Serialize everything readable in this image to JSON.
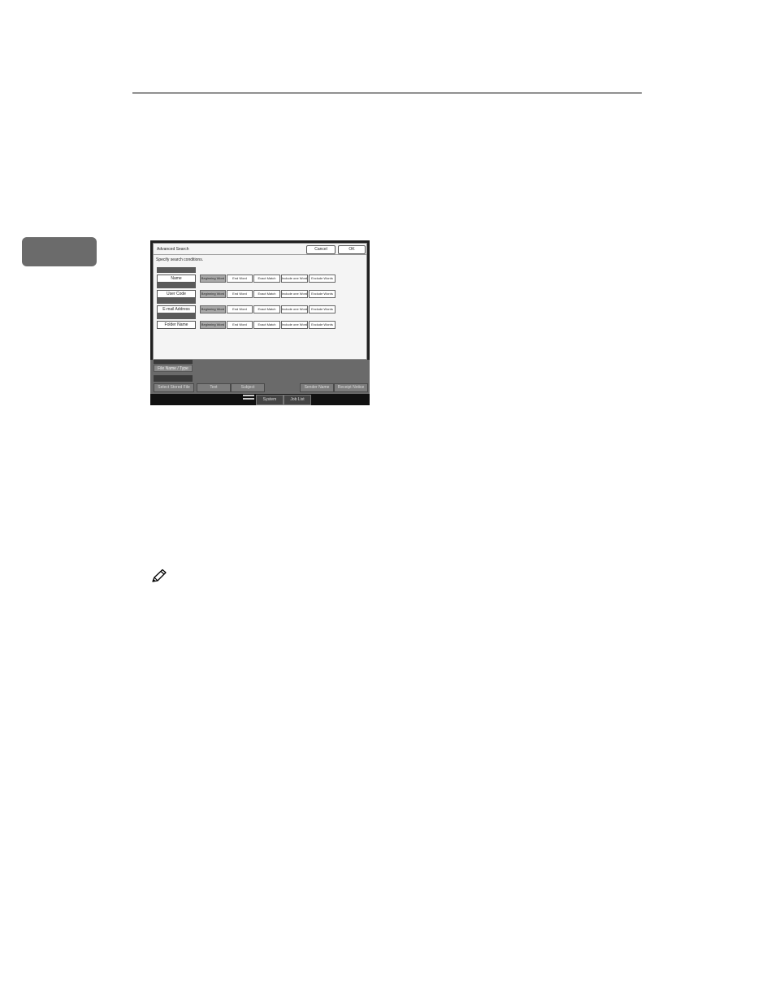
{
  "dialog": {
    "title": "Advanced Search",
    "cancel_label": "Cancel",
    "ok_label": "OK",
    "instruction": "Specify search conditions."
  },
  "search_rows": [
    {
      "label": "Name"
    },
    {
      "label": "User Code"
    },
    {
      "label": "E-mail Address"
    },
    {
      "label": "Folder Name"
    }
  ],
  "search_options": [
    "Beginning Word",
    "End Word",
    "Exact Match",
    "Include one Word",
    "Exclude Words"
  ],
  "selected_option": "Beginning Word",
  "lower_panel": {
    "file_name_tab": "File Name / Type",
    "select_stored_file": "Select Stored File",
    "text": "Text",
    "subject": "Subject",
    "sender_name": "Sender Name",
    "receipt_notice": "Receipt Notice"
  },
  "status_bar": {
    "system_status": "System Status",
    "job_list": "Job List"
  },
  "icons": {
    "note": "pencil-note-icon"
  }
}
